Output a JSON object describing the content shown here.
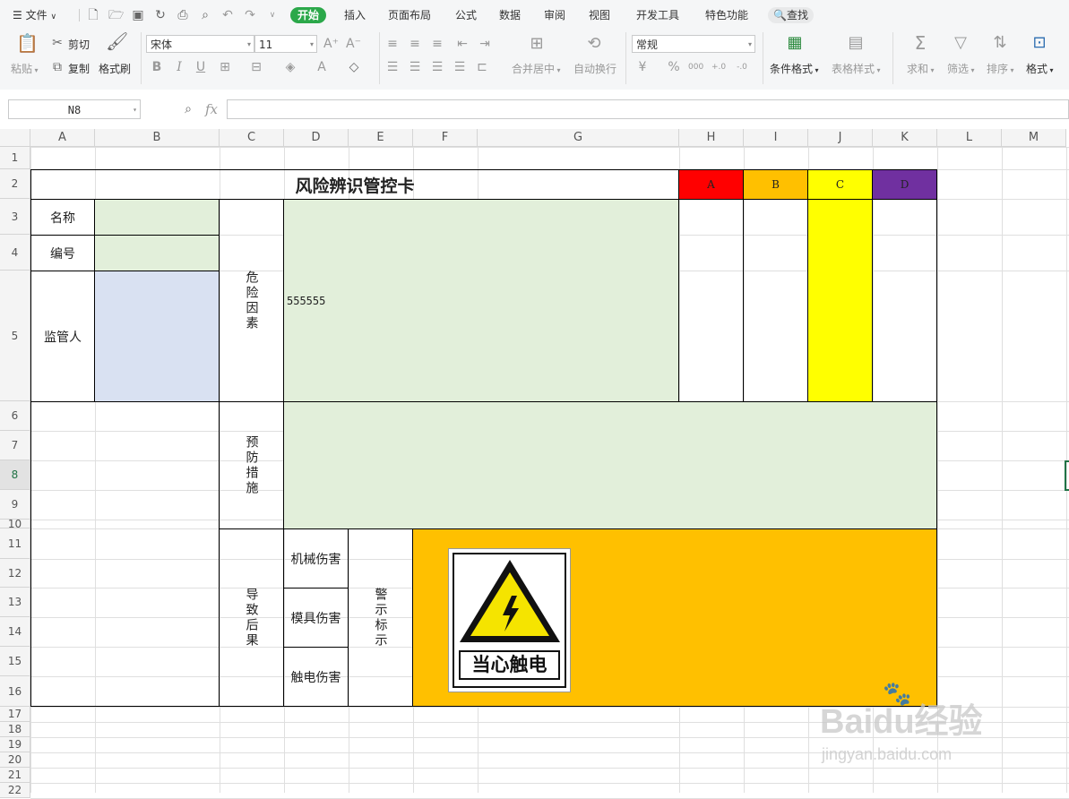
{
  "menu": {
    "file": "文件",
    "tabs": [
      "开始",
      "插入",
      "页面布局",
      "公式",
      "数据",
      "审阅",
      "视图",
      "开发工具",
      "特色功能"
    ],
    "search": "查找"
  },
  "toolbar": {
    "paste": "粘贴",
    "cut": "剪切",
    "copy": "复制",
    "format_painter": "格式刷",
    "font_name": "宋体",
    "font_size": "11",
    "merge_center": "合并居中",
    "wrap_text": "自动换行",
    "number_format": "常规",
    "conditional_format": "条件格式",
    "table_style": "表格样式",
    "sum": "求和",
    "filter": "筛选",
    "sort": "排序",
    "format": "格式"
  },
  "formula_bar": {
    "name_box": "N8",
    "fx": "fx",
    "value": ""
  },
  "columns": [
    "A",
    "B",
    "C",
    "D",
    "E",
    "F",
    "G",
    "H",
    "I",
    "J",
    "K",
    "L",
    "M"
  ],
  "rows": [
    "1",
    "2",
    "3",
    "4",
    "5",
    "6",
    "7",
    "8",
    "9",
    "10",
    "11",
    "12",
    "13",
    "14",
    "15",
    "16",
    "17",
    "18",
    "19",
    "20",
    "21",
    "22"
  ],
  "sheet": {
    "title": "风险辨识管控卡",
    "levels": [
      {
        "label": "A",
        "color": "#ff0000"
      },
      {
        "label": "B",
        "color": "#ffc000"
      },
      {
        "label": "C",
        "color": "#ffff00"
      },
      {
        "label": "D",
        "color": "#7030a0"
      }
    ],
    "name_label": "名称",
    "number_label": "编号",
    "supervisor_label": "监管人",
    "hazard_label": "危险因素",
    "hazard_value": "555555",
    "prevention_label": "预防措施",
    "consequence_label": "导致后果",
    "consequences": [
      "机械伤害",
      "模具伤害",
      "触电伤害"
    ],
    "warning_label": "警示标示",
    "sign_text": "当心触电",
    "colors": {
      "light_green": "#e2efda",
      "light_blue": "#d9e1f2",
      "orange": "#ffc000",
      "yellow": "#ffff00"
    }
  },
  "watermark": {
    "brand": "Baidu经验",
    "url": "jingyan.baidu.com"
  }
}
